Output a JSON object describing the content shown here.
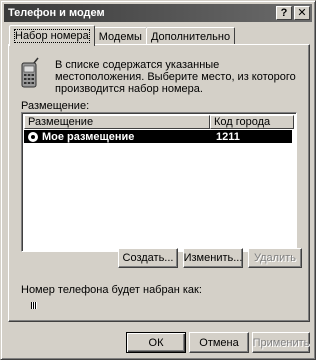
{
  "window": {
    "title": "Телефон и модем",
    "help_button": "?",
    "close_button": "✕"
  },
  "tabs": [
    {
      "label": "Набор номера",
      "active": true
    },
    {
      "label": "Модемы",
      "active": false
    },
    {
      "label": "Дополнительно",
      "active": false
    }
  ],
  "dialing": {
    "icon": "phone-icon",
    "info_text": "В списке содержатся указанные местоположения. Выберите место, из которого производится набор номера.",
    "locations_label": "Размещение:",
    "columns": [
      "Размещение",
      "Код города"
    ],
    "rows": [
      {
        "name": "Мое размещение",
        "area_code": "1211",
        "selected": true
      }
    ],
    "buttons": {
      "create": "Создать...",
      "edit": "Изменить...",
      "delete": "Удалить"
    },
    "dial_as_label": "Номер телефона будет набран как:"
  },
  "footer": {
    "ok": "ОК",
    "cancel": "Отмена",
    "apply": "Применить"
  }
}
